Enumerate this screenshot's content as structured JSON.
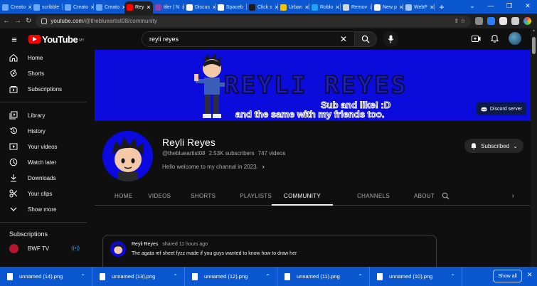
{
  "browser": {
    "tabs": [
      {
        "label": "Creato",
        "color": "#6aa8f7"
      },
      {
        "label": "scribble",
        "color": "#6aa8f7"
      },
      {
        "label": "Creato",
        "color": "#6aa8f7"
      },
      {
        "label": "Creato",
        "color": "#6aa8f7"
      },
      {
        "label": "Rey",
        "color": "#ff0000",
        "active": true
      },
      {
        "label": "tiler | N",
        "color": "#8e44ad"
      },
      {
        "label": "Discus",
        "color": "#ffffff"
      },
      {
        "label": "Spaceb",
        "color": "#ffffff"
      },
      {
        "label": "Click s",
        "color": "#1b1b1b"
      },
      {
        "label": "Urban",
        "color": "#f4c20d"
      },
      {
        "label": "Roblo",
        "color": "#1da1f2"
      },
      {
        "label": "Remov",
        "color": "#cfd8dc"
      },
      {
        "label": "New p",
        "color": "#ffffff"
      },
      {
        "label": "WebP",
        "color": "#9ec5fe"
      }
    ],
    "new_tab": "+",
    "url_host": "youtube.com",
    "url_path": "/@theblueartist08/community"
  },
  "masthead": {
    "logo_word": "YouTube",
    "logo_region": "MY",
    "search_value": "reyli reyes"
  },
  "sidebar": {
    "primary": [
      {
        "label": "Home",
        "icon": "home-icon"
      },
      {
        "label": "Shorts",
        "icon": "shorts-icon"
      },
      {
        "label": "Subscriptions",
        "icon": "subscriptions-icon"
      }
    ],
    "library": [
      {
        "label": "Library",
        "icon": "library-icon"
      },
      {
        "label": "History",
        "icon": "history-icon"
      },
      {
        "label": "Your videos",
        "icon": "your-videos-icon"
      },
      {
        "label": "Watch later",
        "icon": "watch-later-icon"
      },
      {
        "label": "Downloads",
        "icon": "downloads-icon"
      },
      {
        "label": "Your clips",
        "icon": "clips-icon"
      },
      {
        "label": "Show more",
        "icon": "chevron-down-icon"
      }
    ],
    "subscriptions_heading": "Subscriptions",
    "channels": [
      {
        "label": "BWF TV",
        "live": "((•))"
      }
    ]
  },
  "banner": {
    "title": "REYLI REYES",
    "subtitle1": "Sub and like! :D",
    "subtitle2": "and the same with my friends too.",
    "link_label": "Discord server"
  },
  "channel": {
    "name": "Reyli Reyes",
    "handle": "@theblueartist08",
    "subscribers": "2.53K subscribers",
    "videos": "747 videos",
    "about": "Hello welcome to my channal in 2023.",
    "subscribed_label": "Subscribed"
  },
  "channel_tabs": [
    {
      "label": "HOME"
    },
    {
      "label": "VIDEOS"
    },
    {
      "label": "SHORTS"
    },
    {
      "label": "PLAYLISTS"
    },
    {
      "label": "COMMUNITY",
      "active": true
    },
    {
      "label": "CHANNELS"
    },
    {
      "label": "ABOUT"
    }
  ],
  "post": {
    "author": "Reyli Reyes",
    "when": "shared 11 hours ago",
    "text": "The agata ref sheet fyzz made if you guys wanted to know how to draw her"
  },
  "downloads": {
    "files": [
      {
        "name": "unnamed (14).png"
      },
      {
        "name": "unnamed (13).png"
      },
      {
        "name": "unnamed (12).png"
      },
      {
        "name": "unnamed (11).png"
      },
      {
        "name": "unnamed (10).png"
      }
    ],
    "show_all": "Show all"
  },
  "colors": {
    "browser_accent": "#0b57d0",
    "yt_background": "#0f0f0f",
    "banner_blue": "#0b0bdb",
    "brand_red": "#ff0000"
  }
}
